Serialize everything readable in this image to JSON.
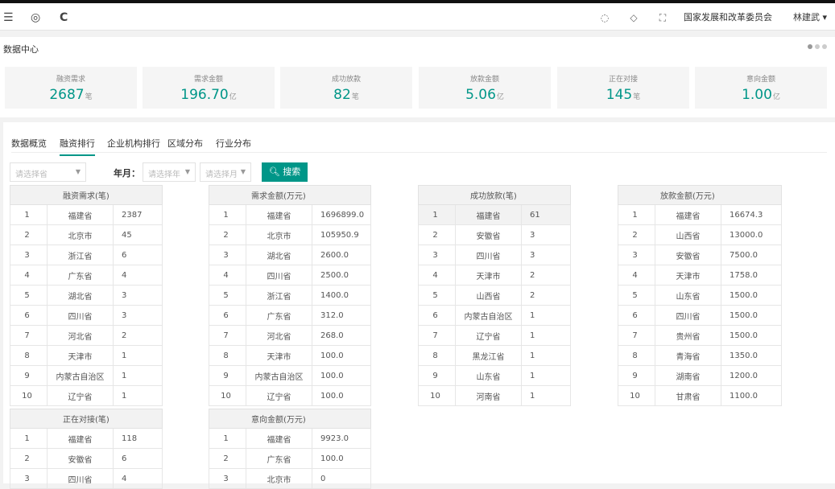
{
  "topbar": {
    "menu_icon": "☰",
    "globe_icon": "◎",
    "refresh_icon": "C",
    "palette_icon": "◌",
    "tag_icon": "◇",
    "fullscreen_icon": "⛶",
    "org": "国家发展和改革委员会",
    "user": "林建武 ▾"
  },
  "crumb": {
    "title": "数据中心"
  },
  "stats": [
    {
      "label": "融资需求",
      "value": "2687",
      "unit": "笔"
    },
    {
      "label": "需求金额",
      "value": "196.70",
      "unit": "亿"
    },
    {
      "label": "成功放款",
      "value": "82",
      "unit": "笔"
    },
    {
      "label": "放款金额",
      "value": "5.06",
      "unit": "亿"
    },
    {
      "label": "正在对接",
      "value": "145",
      "unit": "笔"
    },
    {
      "label": "意向金额",
      "value": "1.00",
      "unit": "亿"
    }
  ],
  "tabs": [
    "数据概览",
    "融资排行",
    "企业机构排行",
    "区域分布",
    "行业分布"
  ],
  "filter": {
    "select1": "请选择省",
    "year_month_label": "年月：",
    "year_placeholder": "请选择年",
    "month_placeholder": "请选择月",
    "search_button": "搜索"
  },
  "tables": [
    {
      "header": "融资需求(笔)",
      "rows": [
        [
          "1",
          "福建省",
          "2387"
        ],
        [
          "2",
          "北京市",
          "45"
        ],
        [
          "3",
          "浙江省",
          "6"
        ],
        [
          "4",
          "广东省",
          "4"
        ],
        [
          "5",
          "湖北省",
          "3"
        ],
        [
          "6",
          "四川省",
          "3"
        ],
        [
          "7",
          "河北省",
          "2"
        ],
        [
          "8",
          "天津市",
          "1"
        ],
        [
          "9",
          "内蒙古自治区",
          "1"
        ],
        [
          "10",
          "辽宁省",
          "1"
        ]
      ]
    },
    {
      "header": "需求金额(万元)",
      "rows": [
        [
          "1",
          "福建省",
          "1696899.0"
        ],
        [
          "2",
          "北京市",
          "105950.9"
        ],
        [
          "3",
          "湖北省",
          "2600.0"
        ],
        [
          "4",
          "四川省",
          "2500.0"
        ],
        [
          "5",
          "浙江省",
          "1400.0"
        ],
        [
          "6",
          "广东省",
          "312.0"
        ],
        [
          "7",
          "河北省",
          "268.0"
        ],
        [
          "8",
          "天津市",
          "100.0"
        ],
        [
          "9",
          "内蒙古自治区",
          "100.0"
        ],
        [
          "10",
          "辽宁省",
          "100.0"
        ]
      ]
    },
    {
      "header": "成功放款(笔)",
      "rows": [
        [
          "1",
          "福建省",
          "61"
        ],
        [
          "2",
          "安徽省",
          "3"
        ],
        [
          "3",
          "四川省",
          "3"
        ],
        [
          "4",
          "天津市",
          "2"
        ],
        [
          "5",
          "山西省",
          "2"
        ],
        [
          "6",
          "内蒙古自治区",
          "1"
        ],
        [
          "7",
          "辽宁省",
          "1"
        ],
        [
          "8",
          "黑龙江省",
          "1"
        ],
        [
          "9",
          "山东省",
          "1"
        ],
        [
          "10",
          "河南省",
          "1"
        ]
      ]
    },
    {
      "header": "放款金额(万元)",
      "rows": [
        [
          "1",
          "福建省",
          "16674.3"
        ],
        [
          "2",
          "山西省",
          "13000.0"
        ],
        [
          "3",
          "安徽省",
          "7500.0"
        ],
        [
          "4",
          "天津市",
          "1758.0"
        ],
        [
          "5",
          "山东省",
          "1500.0"
        ],
        [
          "6",
          "四川省",
          "1500.0"
        ],
        [
          "7",
          "贵州省",
          "1500.0"
        ],
        [
          "8",
          "青海省",
          "1350.0"
        ],
        [
          "9",
          "湖南省",
          "1200.0"
        ],
        [
          "10",
          "甘肃省",
          "1100.0"
        ]
      ]
    },
    {
      "header": "正在对接(笔)",
      "rows": [
        [
          "1",
          "福建省",
          "118"
        ],
        [
          "2",
          "安徽省",
          "6"
        ],
        [
          "3",
          "四川省",
          "4"
        ]
      ]
    },
    {
      "header": "意向金额(万元)",
      "rows": [
        [
          "1",
          "福建省",
          "9923.0"
        ],
        [
          "2",
          "广东省",
          "100.0"
        ],
        [
          "3",
          "北京市",
          "0"
        ]
      ]
    }
  ]
}
